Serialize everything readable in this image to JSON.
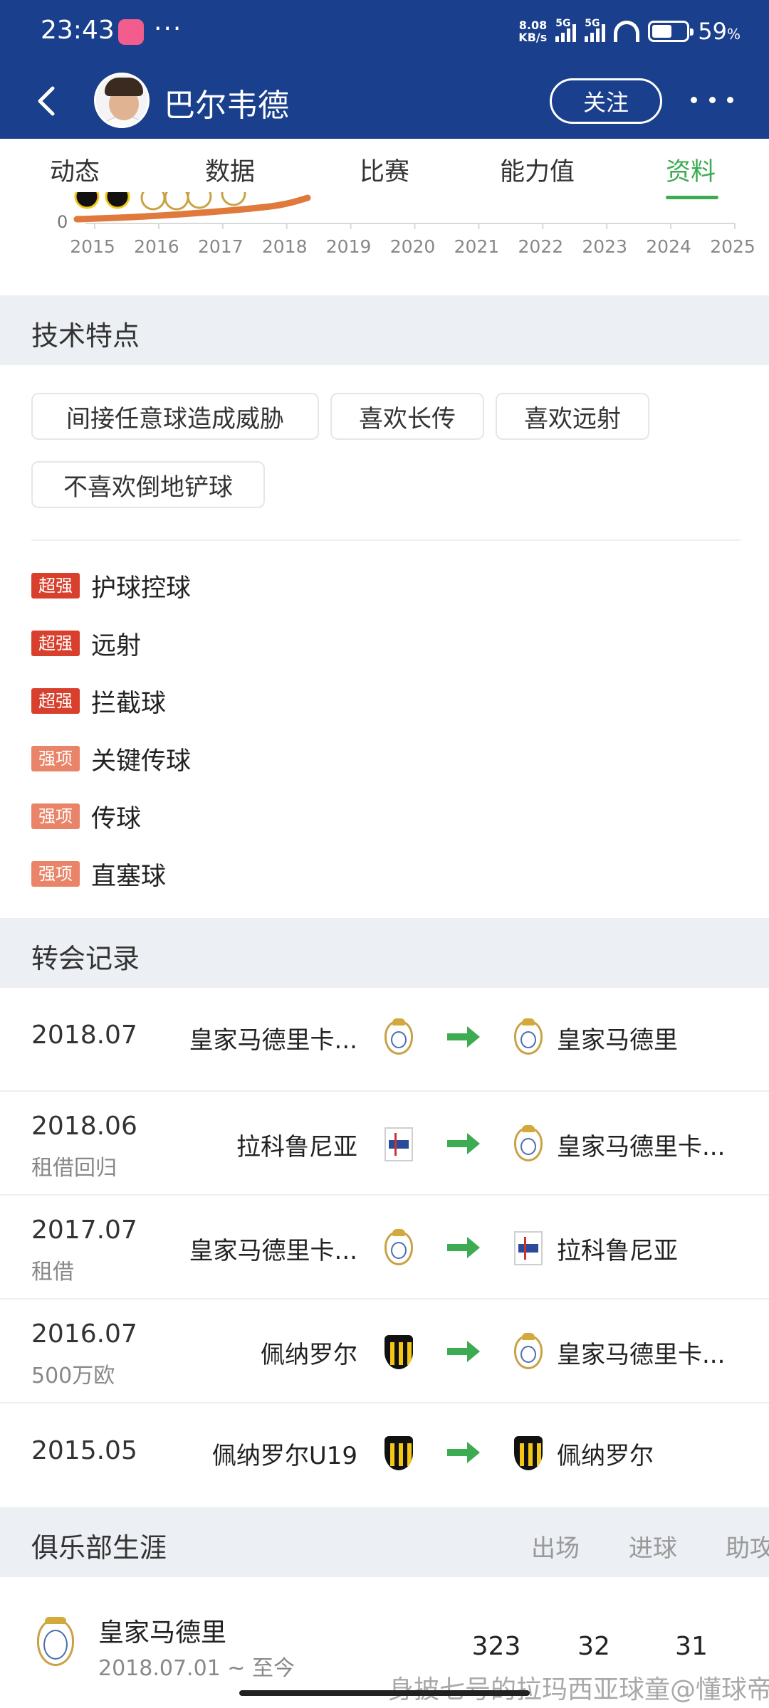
{
  "status": {
    "time": "23:43",
    "net_speed_top": "8.08",
    "net_speed_unit": "KB/s",
    "sim1": "5G",
    "sim2": "5G",
    "battery_pct": "59",
    "battery_unit": "%",
    "battery_level": 0.59
  },
  "header": {
    "player_name": "巴尔韦德",
    "follow_label": "关注"
  },
  "tabs": [
    {
      "label": "动态",
      "active": false
    },
    {
      "label": "数据",
      "active": false
    },
    {
      "label": "比赛",
      "active": false
    },
    {
      "label": "能力值",
      "active": false
    },
    {
      "label": "资料",
      "active": true
    }
  ],
  "chart_data": {
    "type": "line",
    "y_tick_visible": "0",
    "x": [
      "2015",
      "2016",
      "2017",
      "2018",
      "2019",
      "2020",
      "2021",
      "2022",
      "2023",
      "2024",
      "2025"
    ],
    "series_color": "#e07a3c"
  },
  "tech": {
    "title": "技术特点",
    "tags": [
      "间接任意球造成威胁",
      "喜欢长传",
      "喜欢远射",
      "不喜欢倒地铲球"
    ],
    "traits": [
      {
        "level": "超强",
        "kind": "super",
        "label": "护球控球"
      },
      {
        "level": "超强",
        "kind": "super",
        "label": "远射"
      },
      {
        "level": "超强",
        "kind": "super",
        "label": "拦截球"
      },
      {
        "level": "强项",
        "kind": "strong",
        "label": "关键传球"
      },
      {
        "level": "强项",
        "kind": "strong",
        "label": "传球"
      },
      {
        "level": "强项",
        "kind": "strong",
        "label": "直塞球"
      }
    ]
  },
  "transfers": {
    "title": "转会记录",
    "rows": [
      {
        "date": "2018.07",
        "note": "",
        "from": "皇家马德里卡...",
        "from_crest": "real-madrid",
        "to": "皇家马德里",
        "to_crest": "real-madrid"
      },
      {
        "date": "2018.06",
        "note": "租借回归",
        "from": "拉科鲁尼亚",
        "from_crest": "deportivo",
        "to": "皇家马德里卡...",
        "to_crest": "real-madrid"
      },
      {
        "date": "2017.07",
        "note": "租借",
        "from": "皇家马德里卡...",
        "from_crest": "real-madrid",
        "to": "拉科鲁尼亚",
        "to_crest": "deportivo"
      },
      {
        "date": "2016.07",
        "note": "500万欧",
        "from": "佩纳罗尔",
        "from_crest": "penarol",
        "to": "皇家马德里卡...",
        "to_crest": "real-madrid"
      },
      {
        "date": "2015.05",
        "note": "",
        "from": "佩纳罗尔U19",
        "from_crest": "penarol",
        "to": "佩纳罗尔",
        "to_crest": "penarol"
      }
    ]
  },
  "career": {
    "title": "俱乐部生涯",
    "columns": [
      "出场",
      "进球",
      "助攻"
    ],
    "rows": [
      {
        "club": "皇家马德里",
        "period": "2018.07.01 ~ 至今",
        "apps": "323",
        "goals": "32",
        "assists": "31"
      }
    ]
  },
  "watermark": "身披七号的拉玛西亚球童@懂球帝",
  "colors": {
    "header_bg": "#1a3f8c",
    "accent_green": "#3cab52",
    "badge_super": "#d8402d",
    "badge_strong": "#e98468",
    "section_bg": "#eceff3"
  }
}
